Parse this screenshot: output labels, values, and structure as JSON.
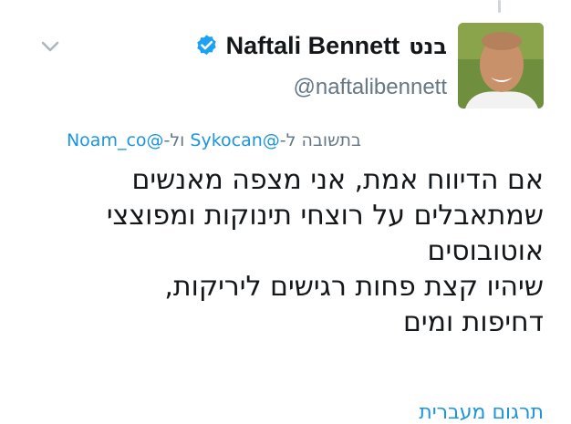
{
  "tweet": {
    "author_name": "Naftali Bennett",
    "author_name_hebrew": "בנט",
    "author_handle": "@naftalibennett",
    "verified": true,
    "reply_prefix": "בתשובה ל-",
    "reply_to_1": "@Sykocan",
    "reply_join": " ול-",
    "reply_to_2": "@Noam_co",
    "text_lines": [
      "אם הדיווח אמת, אני מצפה מאנשים",
      "שמתאבלים על רוצחי תינוקות ומפוצצי",
      "אוטובוסים",
      "שיהיו קצת פחות רגישים ליריקות,",
      "דחיפות ומים"
    ],
    "translate_label": "תרגום מעברית"
  },
  "icons": {
    "menu_caret": "chevron-down-icon",
    "verified_badge": "verified-badge-icon"
  },
  "colors": {
    "link_blue": "#1b95e0",
    "verified_blue": "#1da1f2",
    "secondary_gray": "#657786",
    "text_black": "#14171a"
  }
}
